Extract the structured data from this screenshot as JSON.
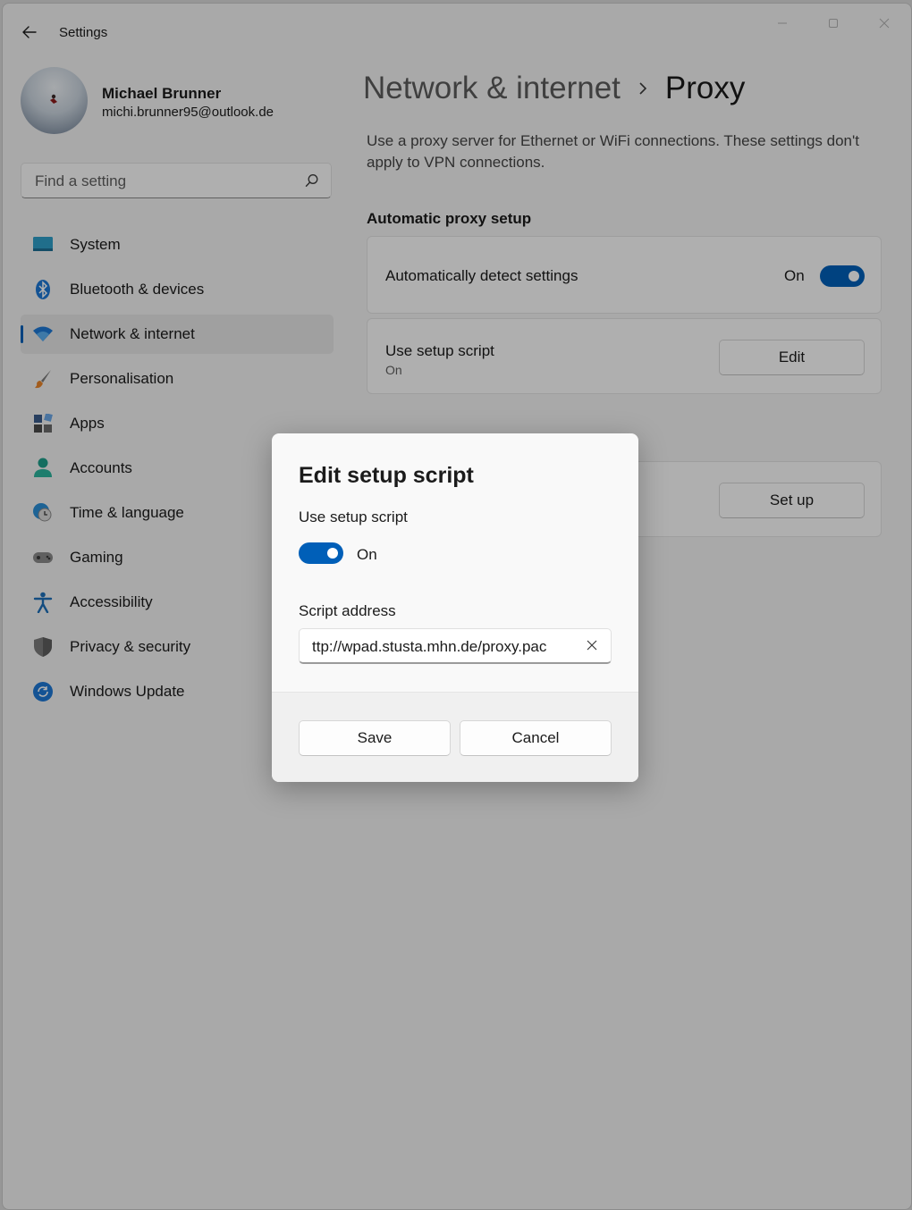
{
  "window": {
    "title": "Settings"
  },
  "profile": {
    "name": "Michael Brunner",
    "email": "michi.brunner95@outlook.de"
  },
  "search": {
    "placeholder": "Find a setting",
    "icon": "search-icon"
  },
  "nav": {
    "items": [
      {
        "label": "System",
        "icon": "system-icon"
      },
      {
        "label": "Bluetooth & devices",
        "icon": "bluetooth-icon"
      },
      {
        "label": "Network & internet",
        "icon": "wifi-icon",
        "selected": true
      },
      {
        "label": "Personalisation",
        "icon": "brush-icon"
      },
      {
        "label": "Apps",
        "icon": "apps-icon"
      },
      {
        "label": "Accounts",
        "icon": "accounts-icon"
      },
      {
        "label": "Time & language",
        "icon": "time-language-icon"
      },
      {
        "label": "Gaming",
        "icon": "gaming-icon"
      },
      {
        "label": "Accessibility",
        "icon": "accessibility-icon"
      },
      {
        "label": "Privacy & security",
        "icon": "shield-icon"
      },
      {
        "label": "Windows Update",
        "icon": "update-icon"
      }
    ]
  },
  "breadcrumb": {
    "parent": "Network & internet",
    "current": "Proxy"
  },
  "content": {
    "description": "Use a proxy server for Ethernet or WiFi connections. These settings don't apply to VPN connections.",
    "auto_section_title": "Automatic proxy setup",
    "auto_detect": {
      "label": "Automatically detect settings",
      "state_text": "On",
      "on": true
    },
    "setup_script": {
      "label": "Use setup script",
      "status": "On",
      "button": "Edit"
    },
    "manual": {
      "button": "Set up"
    }
  },
  "dialog": {
    "title": "Edit setup script",
    "toggle_label": "Use setup script",
    "toggle_state_text": "On",
    "toggle_on": true,
    "address_label": "Script address",
    "address_value": "ttp://wpad.stusta.mhn.de/proxy.pac",
    "save": "Save",
    "cancel": "Cancel"
  },
  "colors": {
    "accent": "#005fb8",
    "window_bg": "#f3f3f3",
    "overlay": "rgba(0,0,0,0.30)"
  }
}
